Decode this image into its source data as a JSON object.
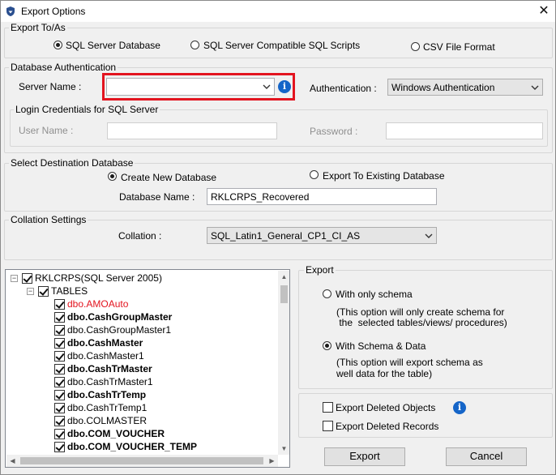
{
  "window": {
    "title": "Export Options",
    "close_glyph": "✕"
  },
  "export_to": {
    "legend": "Export To/As",
    "options": [
      "SQL Server Database",
      "SQL Server Compatible SQL Scripts",
      "CSV File Format"
    ],
    "selected": 0
  },
  "db_auth": {
    "legend": "Database Authentication",
    "server_label": "Server Name :",
    "server_value": "",
    "auth_label": "Authentication :",
    "auth_value": "Windows Authentication"
  },
  "login": {
    "legend": "Login Credentials for SQL Server",
    "user_label": "User Name :",
    "password_label": "Password :"
  },
  "destination": {
    "legend": "Select Destination Database",
    "options": [
      "Create New Database",
      "Export To Existing Database"
    ],
    "selected": 0,
    "db_name_label": "Database Name :",
    "db_name_value": "RKLCRPS_Recovered"
  },
  "collation": {
    "legend": "Collation Settings",
    "label": "Collation :",
    "value": "SQL_Latin1_General_CP1_CI_AS"
  },
  "tree": {
    "root": "RKLCRPS(SQL Server 2005)",
    "tables_node": "TABLES",
    "items": [
      {
        "name": "dbo.AMOAuto",
        "style": "red"
      },
      {
        "name": "dbo.CashGroupMaster",
        "style": "bold"
      },
      {
        "name": "dbo.CashGroupMaster1",
        "style": "normal"
      },
      {
        "name": "dbo.CashMaster",
        "style": "bold"
      },
      {
        "name": "dbo.CashMaster1",
        "style": "normal"
      },
      {
        "name": "dbo.CashTrMaster",
        "style": "bold"
      },
      {
        "name": "dbo.CashTrMaster1",
        "style": "normal"
      },
      {
        "name": "dbo.CashTrTemp",
        "style": "bold"
      },
      {
        "name": "dbo.CashTrTemp1",
        "style": "normal"
      },
      {
        "name": "dbo.COLMASTER",
        "style": "normal"
      },
      {
        "name": "dbo.COM_VOUCHER",
        "style": "bold"
      },
      {
        "name": "dbo.COM_VOUCHER_TEMP",
        "style": "bold"
      }
    ]
  },
  "export": {
    "legend": "Export",
    "schema_only_label": "With only schema",
    "schema_only_desc1": "(This option will only create schema for",
    "schema_only_desc2": " the  selected tables/views/ procedures)",
    "schema_data_label": "With Schema & Data",
    "schema_data_desc1": "(This option will export schema as",
    "schema_data_desc2": "well data for the table)",
    "selected": 1
  },
  "deleted": {
    "objects_label": "Export Deleted Objects",
    "records_label": "Export Deleted Records"
  },
  "buttons": {
    "export": "Export",
    "cancel": "Cancel"
  },
  "colors": {
    "highlight_border": "#e3141f",
    "info_blue": "#1565c8",
    "deleted_item": "#e3141f"
  }
}
